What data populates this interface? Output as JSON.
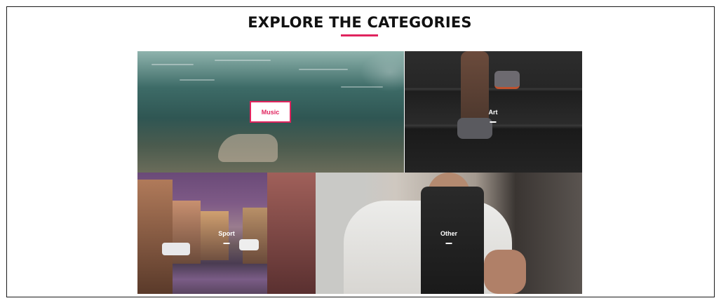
{
  "section": {
    "title": "EXPLORE THE CATEGORIES"
  },
  "categories": [
    {
      "label": "Music",
      "highlighted": true
    },
    {
      "label": "Art",
      "highlighted": false
    },
    {
      "label": "Sport",
      "highlighted": false
    },
    {
      "label": "Other",
      "highlighted": false
    }
  ],
  "colors": {
    "accent": "#e0245e",
    "heading": "#111111",
    "border": "#1a1a1a"
  }
}
